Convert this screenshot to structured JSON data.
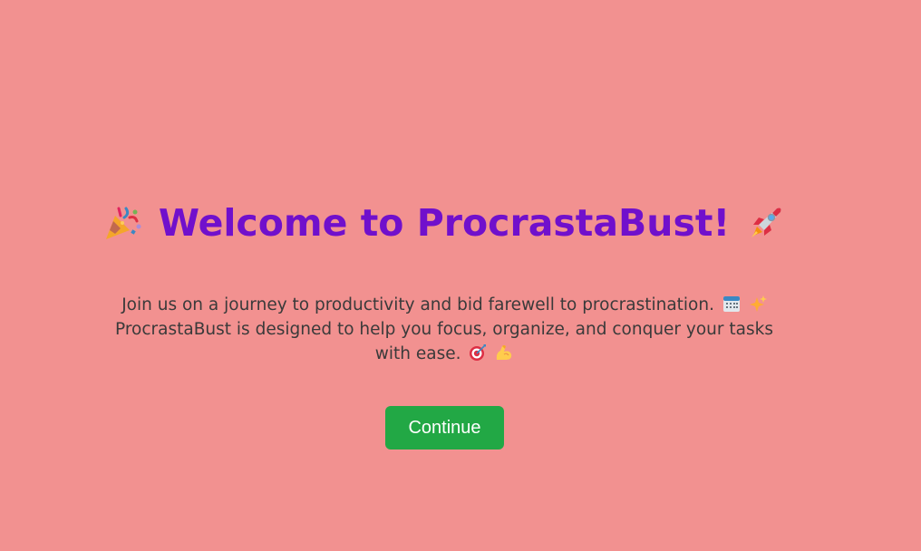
{
  "welcome": {
    "title": "Welcome to ProcrastaBust!",
    "title_icon_left": "party-popper-icon",
    "title_icon_right": "rocket-icon",
    "description_line": "Join us on a journey to productivity and bid farewell to procrastination.",
    "description_icons_1": [
      "calendar-icon",
      "sparkles-icon"
    ],
    "description_line2": "ProcrastaBust is designed to help you focus, organize, and conquer your tasks with ease.",
    "description_icons_2": [
      "target-icon",
      "flexed-biceps-icon"
    ],
    "continue_label": "Continue"
  },
  "colors": {
    "background": "#f29190",
    "title": "#7010cc",
    "text": "#3a3a3a",
    "button": "#22a845",
    "button_text": "#ffffff"
  }
}
